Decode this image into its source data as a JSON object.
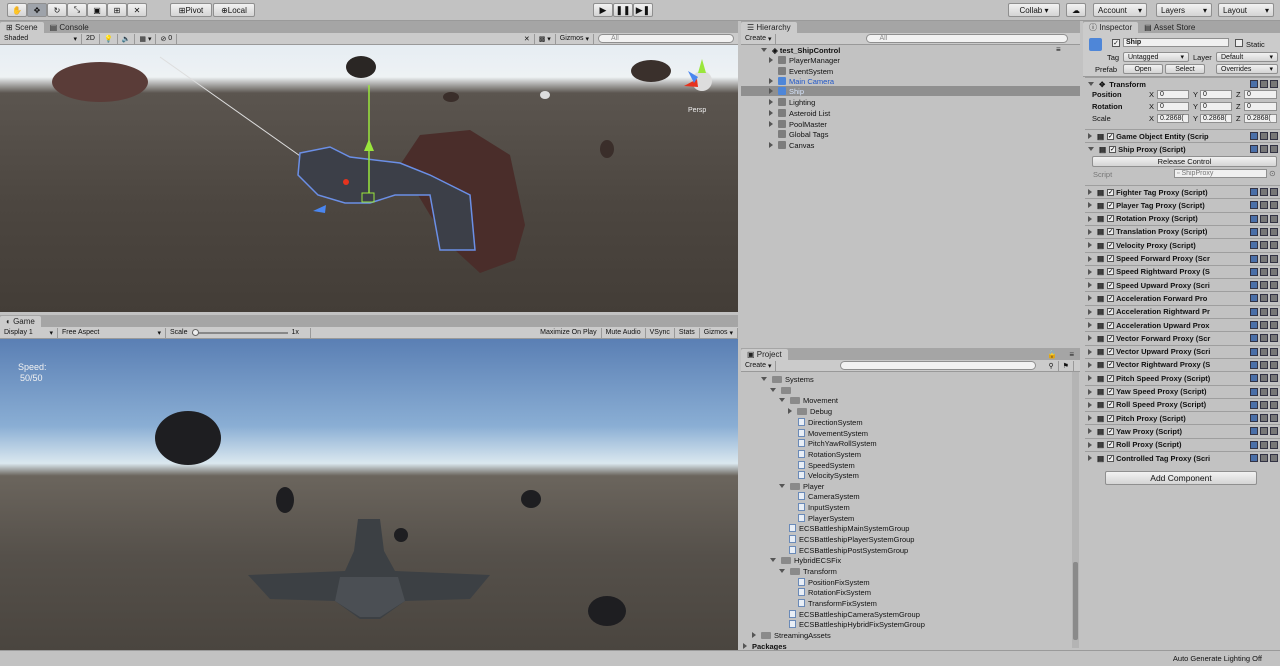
{
  "toolbar": {
    "pivot": "Pivot",
    "local": "Local",
    "collab": "Collab",
    "account": "Account",
    "layers": "Layers",
    "layout": "Layout"
  },
  "scene": {
    "tab_scene": "Scene",
    "tab_console": "Console",
    "shading": "Shaded",
    "mode2d": "2D",
    "gizmos": "Gizmos",
    "search_placeholder": "All",
    "counter": "0",
    "persp": "Persp"
  },
  "game": {
    "tab": "Game",
    "display": "Display 1",
    "aspect": "Free Aspect",
    "scale_label": "Scale",
    "scale_value": "1x",
    "maximize": "Maximize On Play",
    "mute": "Mute Audio",
    "vsync": "VSync",
    "stats": "Stats",
    "gizmos": "Gizmos",
    "speed_label": "Speed:",
    "speed_value": "50/50"
  },
  "hierarchy": {
    "tab": "Hierarchy",
    "create": "Create",
    "search_placeholder": "All",
    "scene": "test_ShipControl",
    "items": [
      "PlayerManager",
      "EventSystem",
      "Main Camera",
      "Ship",
      "Lighting",
      "Asteroid List",
      "PoolMaster",
      "Global Tags",
      "Canvas"
    ]
  },
  "project": {
    "tab": "Project",
    "create": "Create",
    "items": [
      "Systems",
      "",
      "Movement",
      "Debug",
      "DirectionSystem",
      "MovementSystem",
      "PitchYawRollSystem",
      "RotationSystem",
      "SpeedSystem",
      "VelocitySystem",
      "Player",
      "CameraSystem",
      "InputSystem",
      "PlayerSystem",
      "ECSBattleshipMainSystemGroup",
      "ECSBattleshipPlayerSystemGroup",
      "ECSBattleshipPostSystemGroup",
      "HybridECSFix",
      "Transform",
      "PositionFixSystem",
      "RotationFixSystem",
      "TransformFixSystem",
      "ECSBattleshipCameraSystemGroup",
      "ECSBattleshipHybridFixSystemGroup",
      "StreamingAssets",
      "Packages"
    ]
  },
  "inspector": {
    "tab_inspector": "Inspector",
    "tab_store": "Asset Store",
    "name": "Ship",
    "static": "Static",
    "tag_label": "Tag",
    "tag_value": "Untagged",
    "layer_label": "Layer",
    "layer_value": "Default",
    "prefab_label": "Prefab",
    "open": "Open",
    "select": "Select",
    "overrides": "Overrides",
    "transform": "Transform",
    "position": "Position",
    "rotation": "Rotation",
    "scale": "Scale",
    "pos": [
      "0",
      "0",
      "0"
    ],
    "rot": [
      "0",
      "0",
      "0"
    ],
    "scl": [
      "0.2868(",
      "0.2868(",
      "0.2868("
    ],
    "x": "X",
    "y": "Y",
    "z": "Z",
    "components": [
      "Game Object Entity (Scrip",
      "Ship Proxy (Script)"
    ],
    "release": "Release Control",
    "script_label": "Script",
    "script_value": "ShipProxy",
    "components2": [
      "Fighter Tag Proxy (Script)",
      "Player Tag Proxy (Script)",
      "Rotation Proxy (Script)",
      "Translation Proxy (Script)",
      "Velocity Proxy (Script)",
      "Speed Forward Proxy (Scr",
      "Speed Rightward Proxy (S",
      "Speed Upward Proxy (Scri",
      "Acceleration Forward Pro",
      "Acceleration Rightward Pr",
      "Acceleration Upward Prox",
      "Vector Forward Proxy (Scr",
      "Vector Upward Proxy (Scri",
      "Vector Rightward Proxy (S",
      "Pitch Speed Proxy (Script)",
      "Yaw Speed Proxy (Script)",
      "Roll Speed Proxy (Script)",
      "Pitch Proxy (Script)",
      "Yaw Proxy (Script)",
      "Roll Proxy (Script)",
      "Controlled Tag Proxy (Scri"
    ],
    "add_component": "Add Component"
  },
  "status": {
    "lighting": "Auto Generate Lighting Off"
  }
}
